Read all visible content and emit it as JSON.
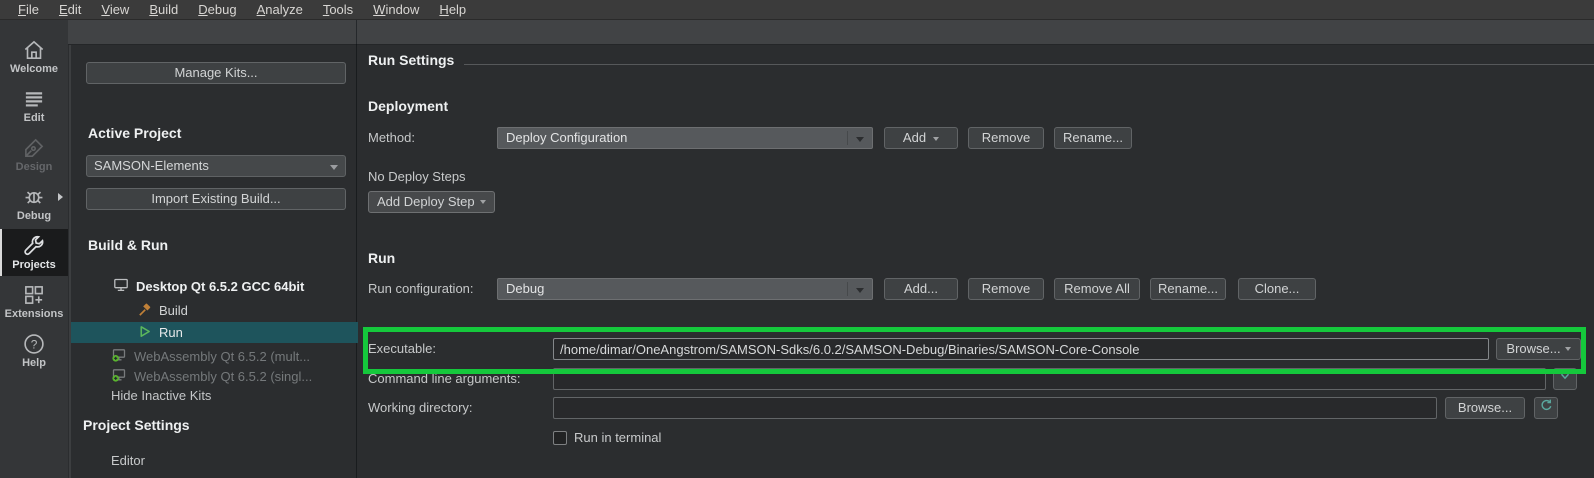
{
  "menu_bar": {
    "items": [
      "File",
      "Edit",
      "View",
      "Build",
      "Debug",
      "Analyze",
      "Tools",
      "Window",
      "Help"
    ]
  },
  "mode_sidebar": {
    "items": [
      {
        "label": "Welcome",
        "icon": "home-icon",
        "state": "normal"
      },
      {
        "label": "Edit",
        "icon": "document-lines-icon",
        "state": "normal"
      },
      {
        "label": "Design",
        "icon": "pen-icon",
        "state": "disabled"
      },
      {
        "label": "Debug",
        "icon": "bug-icon",
        "state": "normal",
        "has_flyout": true
      },
      {
        "label": "Projects",
        "icon": "wrench-icon",
        "state": "selected"
      },
      {
        "label": "Extensions",
        "icon": "extensions-icon",
        "state": "normal"
      },
      {
        "label": "Help",
        "icon": "help-icon",
        "state": "normal"
      }
    ],
    "help_glyph": "?"
  },
  "left_panel": {
    "manage_kits_button": "Manage Kits...",
    "active_project_heading": "Active Project",
    "project_selector_value": "SAMSON-Elements",
    "import_build_button": "Import Existing Build...",
    "build_run_heading": "Build & Run",
    "kit_name": "Desktop Qt 6.5.2 GCC 64bit",
    "kit_build": "Build",
    "kit_run": "Run",
    "inactive_kits": [
      "WebAssembly Qt 6.5.2 (mult...",
      "WebAssembly Qt 6.5.2 (singl..."
    ],
    "hide_inactive_kits": "Hide Inactive Kits",
    "project_settings_heading": "Project Settings",
    "editor_item": "Editor"
  },
  "main": {
    "title": "Run Settings",
    "deployment": {
      "heading": "Deployment",
      "method_label": "Method:",
      "method_value": "Deploy Configuration",
      "add_button": "Add",
      "remove_button": "Remove",
      "rename_button": "Rename...",
      "no_deploy_steps": "No Deploy Steps",
      "add_deploy_step_button": "Add Deploy Step"
    },
    "run": {
      "heading": "Run",
      "config_label": "Run configuration:",
      "config_value": "Debug",
      "add_button": "Add...",
      "remove_button": "Remove",
      "remove_all_button": "Remove All",
      "rename_button": "Rename...",
      "clone_button": "Clone...",
      "executable_label": "Executable:",
      "executable_value": "/home/dimar/OneAngstrom/SAMSON-Sdks/6.0.2/SAMSON-Debug/Binaries/SAMSON-Core-Console",
      "executable_browse_button": "Browse...",
      "args_label": "Command line arguments:",
      "args_value": "",
      "workdir_label": "Working directory:",
      "workdir_value": "",
      "workdir_browse_button": "Browse...",
      "terminal_label": "Run in terminal",
      "terminal_checked": false
    }
  },
  "colors": {
    "annotation_green": "#15c83c",
    "selection_teal": "#1e545c",
    "run_icon_green": "#5cb85c",
    "hammer_orange": "#c08038",
    "panel_background": "#2b2d2f",
    "menubar_background": "#3b3b3b"
  }
}
